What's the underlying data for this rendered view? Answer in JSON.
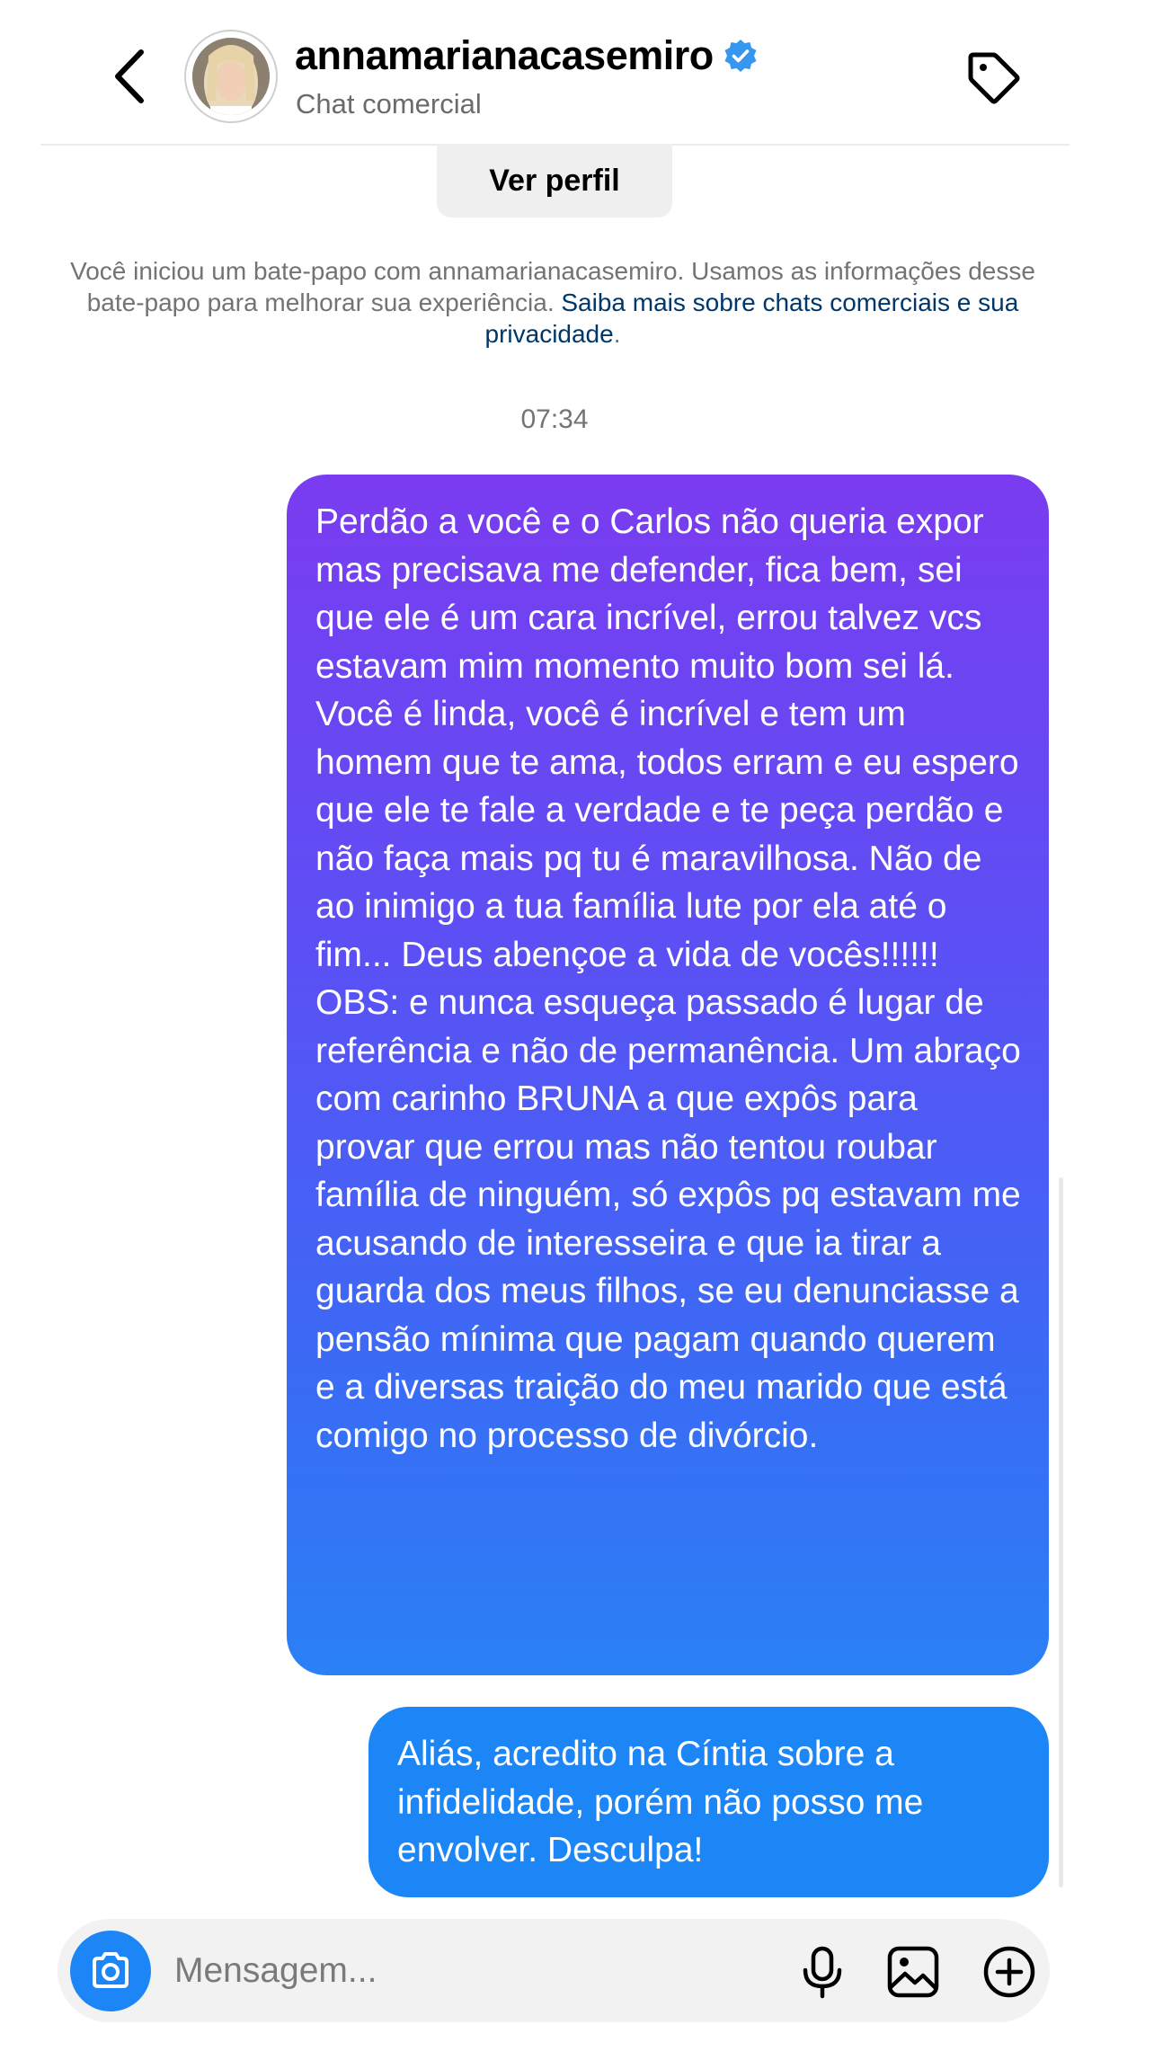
{
  "header": {
    "username": "annamarianacasemiro",
    "subtitle": "Chat comercial",
    "verified": true
  },
  "profile_button": "Ver perfil",
  "info": {
    "text": "Você iniciou um bate-papo com annamarianacasemiro. Usamos as informações desse bate-papo para melhorar sua experiência.",
    "link": "Saiba mais sobre chats comerciais e sua privacidade",
    "end": "."
  },
  "timestamp": "07:34",
  "messages": [
    {
      "from": "me",
      "text": "Perdão a você e o Carlos não queria expor mas precisava me defender, fica bem, sei que ele é um cara incrível, errou talvez vcs estavam mim momento muito bom sei lá. Você é linda, você é incrível e tem um homem que te ama, todos erram e eu espero que ele te fale a verdade e te peça perdão e não faça mais pq tu é maravilhosa. Não de ao inimigo a tua família lute por ela até o fim... Deus abençoe a vida de vocês!!!!!! OBS: e nunca esqueça passado é lugar de referência e não de permanência. Um abraço com carinho BRUNA a que expôs para provar que errou mas não tentou roubar família de ninguém, só expôs pq estavam me acusando de interesseira e que ia tirar a guarda dos meus filhos, se eu denunciasse a pensão mínima que pagam quando querem e a diversas traição do meu marido que está comigo no processo de divórcio."
    },
    {
      "from": "me",
      "text": "Aliás, acredito na Cíntia sobre a infidelidade, porém não posso me envolver. Desculpa!"
    }
  ],
  "composer": {
    "placeholder": "Mensagem...",
    "value": ""
  },
  "icons": {
    "back": "chevron-left-icon",
    "verified": "verified-badge-icon",
    "tag": "tag-icon",
    "camera": "camera-icon",
    "mic": "microphone-icon",
    "gallery": "image-icon",
    "plus": "plus-circle-icon"
  },
  "colors": {
    "bubble_gradient_top": "#7a3cf0",
    "bubble_gradient_bottom": "#2a80f5",
    "bubble_blue": "#1d86f7",
    "verified": "#3797f0",
    "link": "#00376b"
  }
}
